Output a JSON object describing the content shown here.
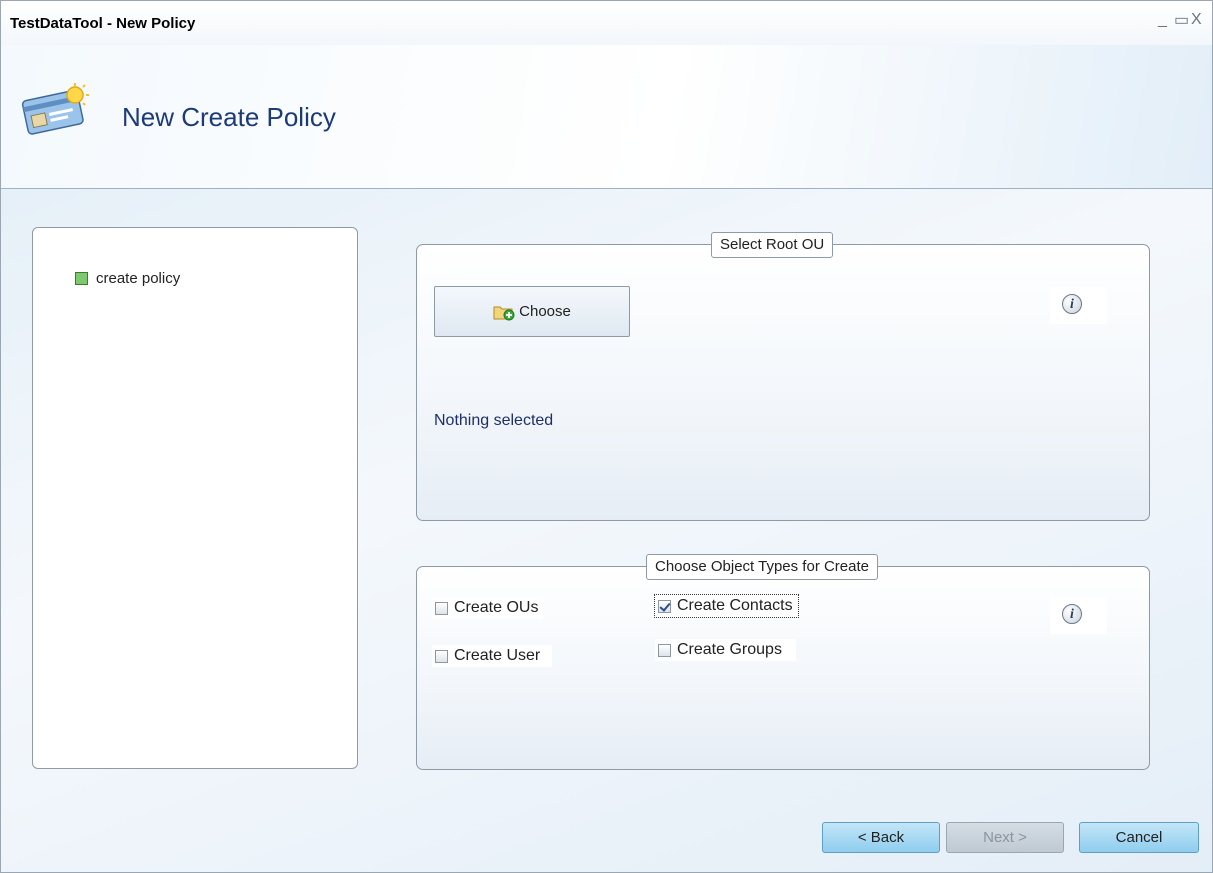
{
  "window": {
    "title": "TestDataTool - New Policy",
    "controls": {
      "minimize": "_",
      "maximize": "▭",
      "close": "X"
    }
  },
  "header": {
    "title": "New Create Policy",
    "icon": "policy-card-icon"
  },
  "tree": {
    "items": [
      {
        "label": "create policy",
        "icon": "green-square-icon"
      }
    ]
  },
  "root_ou": {
    "legend": "Select Root OU",
    "choose_label": "Choose",
    "choose_icon": "folder-add-icon",
    "status": "Nothing selected",
    "info_icon": "info-icon"
  },
  "object_types": {
    "legend": "Choose Object Types for Create",
    "info_icon": "info-icon",
    "options": [
      {
        "label": "Create OUs",
        "checked": false
      },
      {
        "label": "Create Contacts",
        "checked": true
      },
      {
        "label": "Create User",
        "checked": false
      },
      {
        "label": "Create Groups",
        "checked": false
      }
    ]
  },
  "footer": {
    "back_label": "< Back",
    "next_label": "Next >",
    "cancel_label": "Cancel"
  },
  "colors": {
    "header_title": "#1d3a78",
    "status_text": "#1d2f6b",
    "primary_button": "#8fcdee",
    "tree_marker": "#7ec86d"
  }
}
